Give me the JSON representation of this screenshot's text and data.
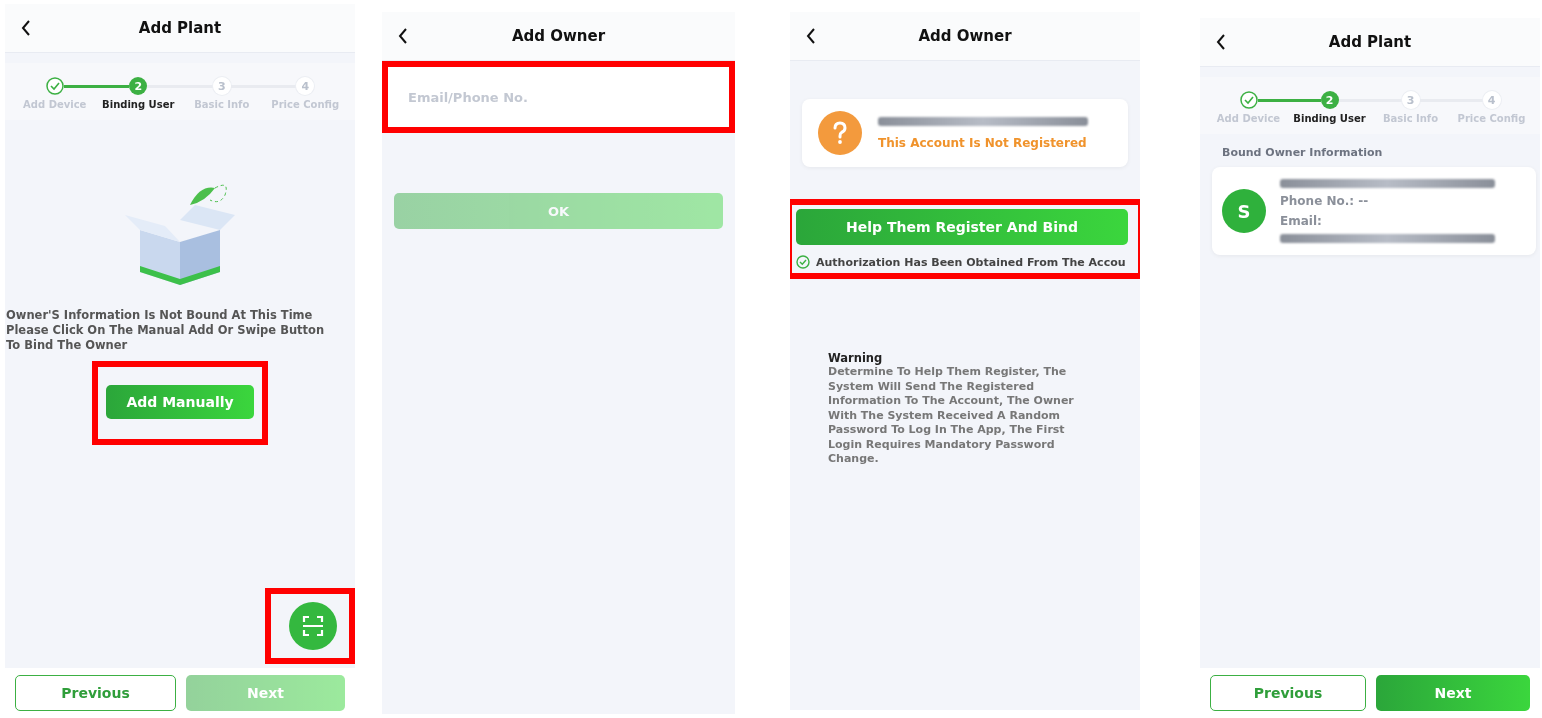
{
  "screens": [
    {
      "kind": "binding_empty",
      "title": "Add Plant",
      "steps": [
        {
          "label": "Add Device",
          "completed": true,
          "selected": false
        },
        {
          "number": "2",
          "label": "Binding User",
          "completed": false,
          "selected": true
        },
        {
          "number": "3",
          "label": "Basic Info",
          "completed": false,
          "selected": false
        },
        {
          "number": "4",
          "label": "Price Config",
          "completed": false,
          "selected": false
        }
      ],
      "message_lines": [
        "Owner'S Information Is Not Bound At This Time",
        "Please Click On The Manual Add Or Swipe Button",
        "To Bind The Owner"
      ],
      "action": {
        "label": "Add Manually",
        "highlighted": true
      },
      "scan_highlighted": true,
      "footer": [
        {
          "label": "Previous",
          "disabled": false,
          "primary": false
        },
        {
          "label": "Next",
          "disabled": true,
          "primary": true
        }
      ]
    },
    {
      "kind": "add_owner_input",
      "title": "Add Owner",
      "field": {
        "placeholder": "Email/Phone No.",
        "highlighted": true
      },
      "ok": {
        "label": "OK",
        "disabled": true
      }
    },
    {
      "kind": "add_owner_unregistered",
      "title": "Add Owner",
      "account_status": "This Account Is Not Registered",
      "action": {
        "label": "Help Them Register And Bind",
        "highlighted": true
      },
      "consent": {
        "label": "Authorization Has Been Obtained From The Accou",
        "checked": true
      },
      "warning_title": "Warning",
      "warning_text": "Determine To Help Them Register, The System Will Send The Registered Information To The Account, The Owner With The System Received A Random Password To Log In The App, The First Login Requires Mandatory Password Change."
    },
    {
      "kind": "binding_bound",
      "title": "Add Plant",
      "steps": [
        {
          "label": "Add Device",
          "completed": true,
          "selected": false
        },
        {
          "number": "2",
          "label": "Binding User",
          "completed": false,
          "selected": true
        },
        {
          "number": "3",
          "label": "Basic Info",
          "completed": false,
          "selected": false
        },
        {
          "number": "4",
          "label": "Price Config",
          "completed": false,
          "selected": false
        }
      ],
      "section_title": "Bound Owner Information",
      "avatar_letter": "S",
      "phone_label": "Phone No.: --",
      "email_label": "Email:",
      "footer": [
        {
          "label": "Previous",
          "disabled": false,
          "primary": false
        },
        {
          "label": "Next",
          "disabled": false,
          "primary": true
        }
      ]
    }
  ]
}
